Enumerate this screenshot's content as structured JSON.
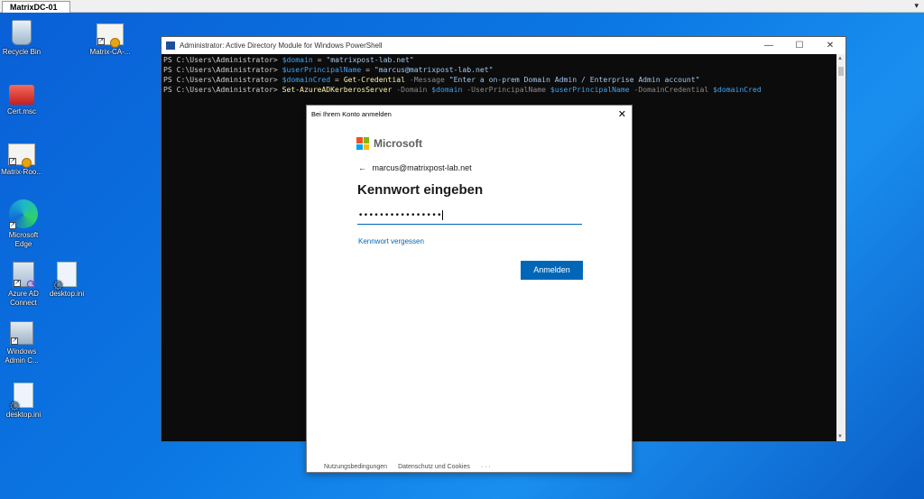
{
  "rdp": {
    "tab_label": "MatrixDC-01",
    "chevron": "▾"
  },
  "desktop": {
    "icons": [
      {
        "label": "Recycle Bin"
      },
      {
        "label": "Matrix-CA-..."
      },
      {
        "label": "Cert.msc"
      },
      {
        "label": "Matrix-Roo..."
      },
      {
        "label": "Microsoft Edge"
      },
      {
        "label": "Azure AD Connect"
      },
      {
        "label": "desktop.ini"
      },
      {
        "label": "Windows Admin C..."
      },
      {
        "label": "desktop.ini"
      }
    ]
  },
  "powershell": {
    "title": "Administrator: Active Directory Module for Windows PowerShell",
    "controls": {
      "minimize": "—",
      "maximize": "☐",
      "close": "✕"
    },
    "prompt": "PS C:\\Users\\Administrator> ",
    "lines": [
      {
        "var": "$domain",
        "op": " = ",
        "str": "\"matrixpost-lab.net\""
      },
      {
        "var": "$userPrincipalName",
        "op": " = ",
        "str": "\"marcus@matrixpost-lab.net\""
      },
      {
        "var": "$domainCred",
        "op": " = ",
        "cmd": "Get-Credential",
        "par": " -Message ",
        "str": "\"Enter a on-prem Domain Admin / Enterprise Admin account\""
      },
      {
        "cmd": "Set-AzureADKerberosServer",
        "p1": " -Domain ",
        "v1": "$domain",
        "p2": " -UserPrincipalName ",
        "v2": "$userPrincipalName",
        "p3": " -DomainCredential ",
        "v3": "$domainCred"
      }
    ]
  },
  "dialog": {
    "title": "Bei Ihrem Konto anmelden",
    "close": "✕",
    "brand": "Microsoft",
    "brand_colors": [
      "#f25022",
      "#7fba00",
      "#00a4ef",
      "#ffb900"
    ],
    "back_arrow": "←",
    "account": "marcus@matrixpost-lab.net",
    "heading": "Kennwort eingeben",
    "password_mask": "••••••••••••••••",
    "forgot_link": "Kennwort vergessen",
    "submit": "Anmelden",
    "footer": {
      "terms": "Nutzungsbedingungen",
      "privacy": "Datenschutz und Cookies",
      "more": "· · ·"
    }
  }
}
